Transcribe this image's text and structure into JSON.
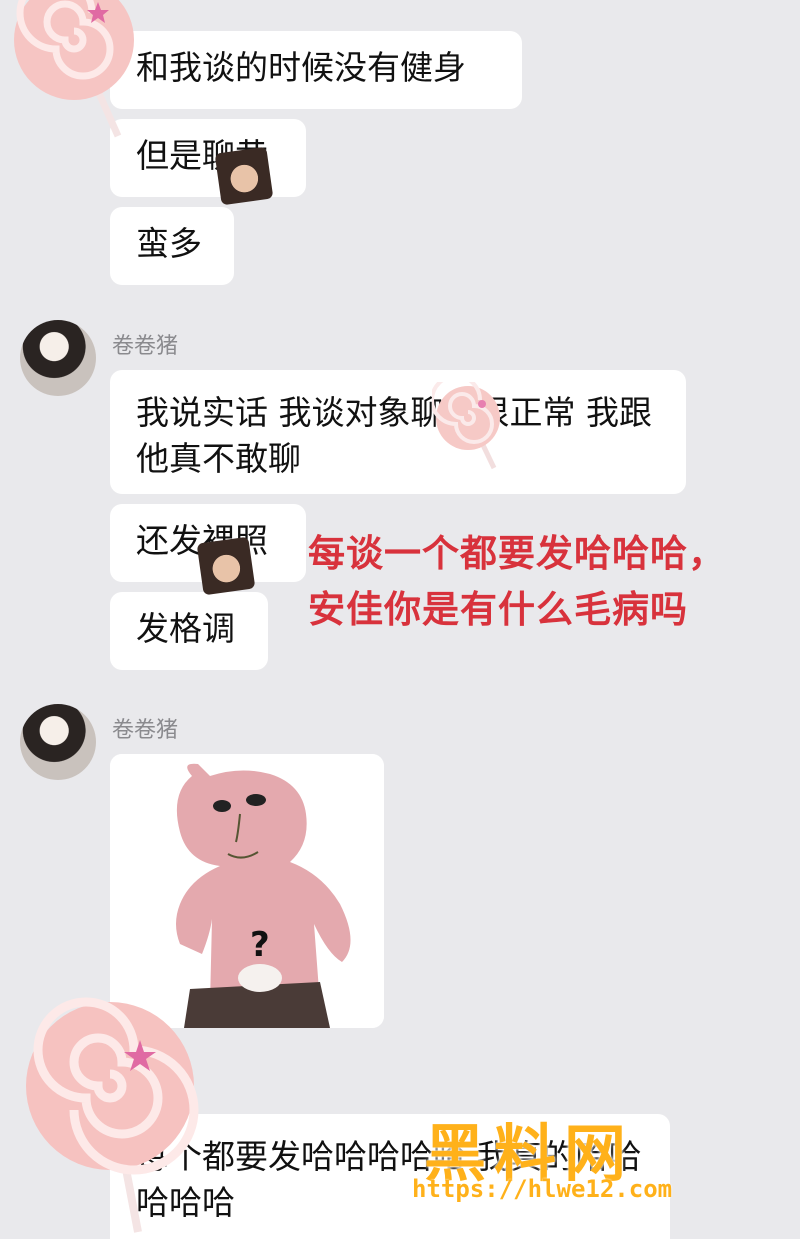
{
  "messages_top": [
    {
      "text": "和我谈的时候没有健身"
    },
    {
      "text": "但是聊黄"
    },
    {
      "text": "蛮多"
    }
  ],
  "sender": {
    "name": "卷卷猪"
  },
  "messages_mid": [
    {
      "text": "我说实话 我谈对象聊黄很正常 我跟他真不敢聊"
    },
    {
      "text": "还发裸照"
    },
    {
      "text": "发格调"
    }
  ],
  "sticker": {
    "caption": "?"
  },
  "bottom_message": {
    "text": "每个都要发哈哈哈哈哈 我真的哈哈哈哈哈"
  },
  "annotation": {
    "text": "每谈一个都要发哈哈哈，安佳你是有什么毛病吗"
  },
  "watermark": {
    "logo": "黑料网",
    "url": "https://hlwe12.com"
  },
  "colors": {
    "annotation": "#d8323c",
    "watermark": "#ffb11a",
    "background": "#e9e9ec"
  }
}
